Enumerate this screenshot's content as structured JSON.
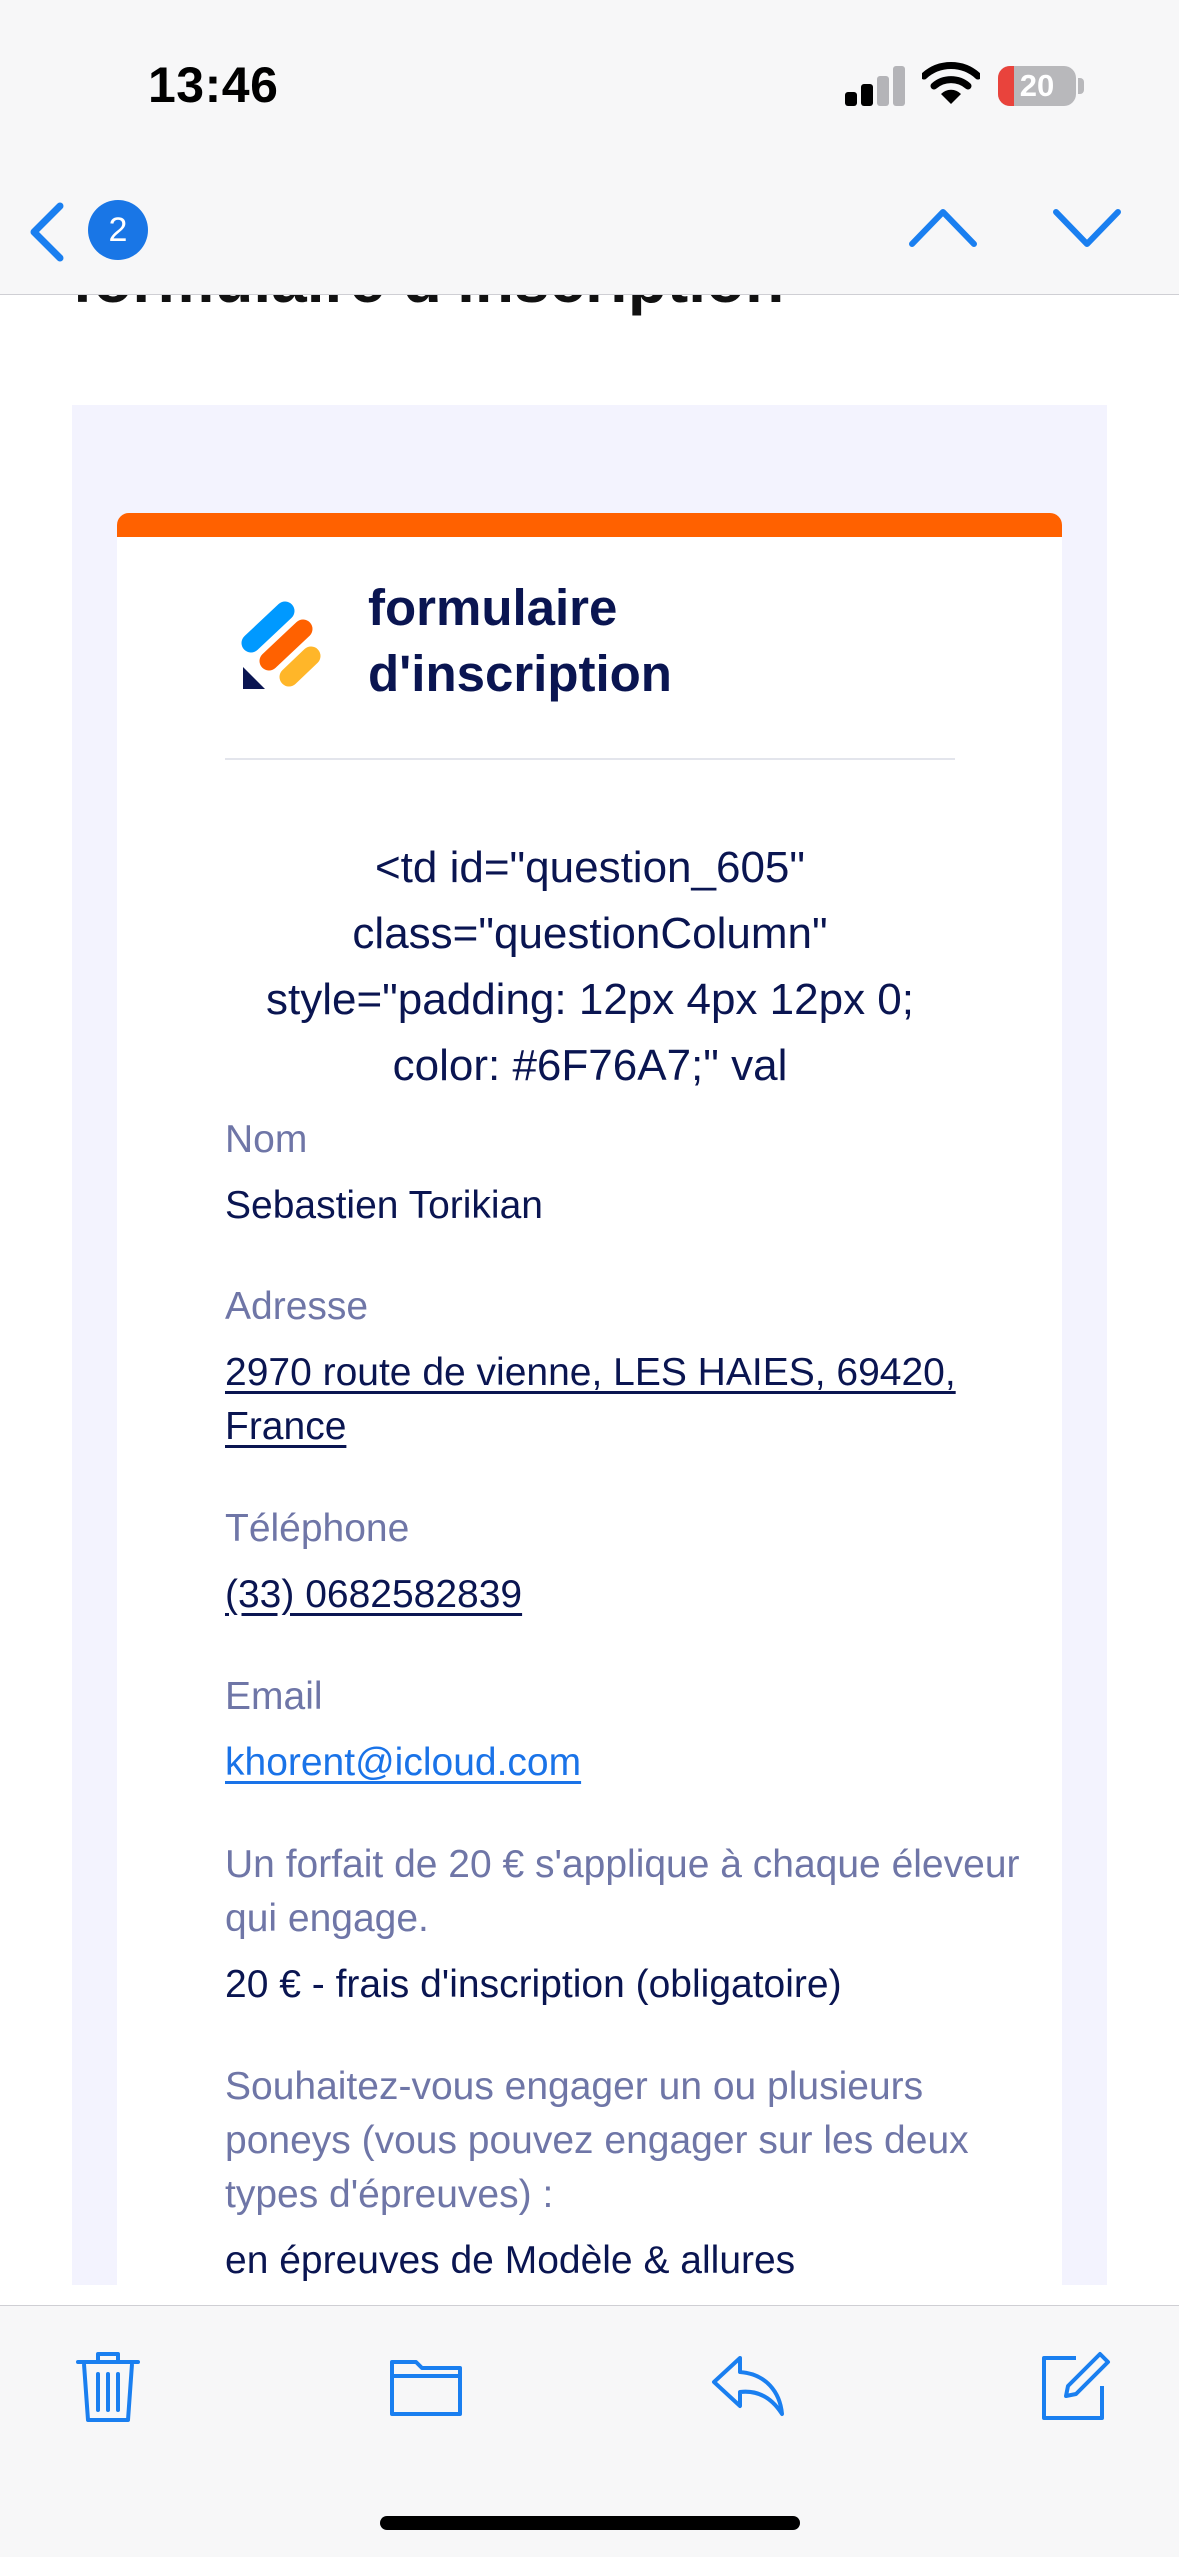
{
  "status_bar": {
    "time": "13:46",
    "battery": "20"
  },
  "nav": {
    "unread_count": "2"
  },
  "email": {
    "subject": "formulaire d'inscription"
  },
  "form": {
    "title": "formulaire d'inscription",
    "raw_html_text": "<td id=\"question_605\" class=\"questionColumn\" style=\"padding: 12px 4px 12px 0; color: #6F76A7;\" val",
    "fields": [
      {
        "label": "Nom",
        "value": "Sebastien Torikian"
      },
      {
        "label": "Adresse",
        "value": "2970 route de vienne, LES HAIES, 69420, France"
      },
      {
        "label": "Téléphone",
        "value": "(33) 0682582839"
      },
      {
        "label": "Email",
        "value": "khorent@icloud.com"
      },
      {
        "label": "Un forfait de 20 € s'applique à chaque éleveur qui engage.",
        "value": "20 € - frais d'inscription (obligatoire)"
      },
      {
        "label": "Souhaitez-vous engager un ou plusieurs poneys (vous pouvez engager sur les deux types d'épreuves) :",
        "value": "en épreuves de Modèle & allures"
      }
    ]
  },
  "toolbar": {
    "icons": [
      "trash-icon",
      "folder-icon",
      "reply-icon",
      "compose-icon"
    ]
  },
  "colors": {
    "accent": "#1976e6",
    "brand_orange": "#ff6100",
    "form_navy": "#0a1551",
    "label_gray": "#6f76a7",
    "link_blue": "#1a73e8"
  }
}
